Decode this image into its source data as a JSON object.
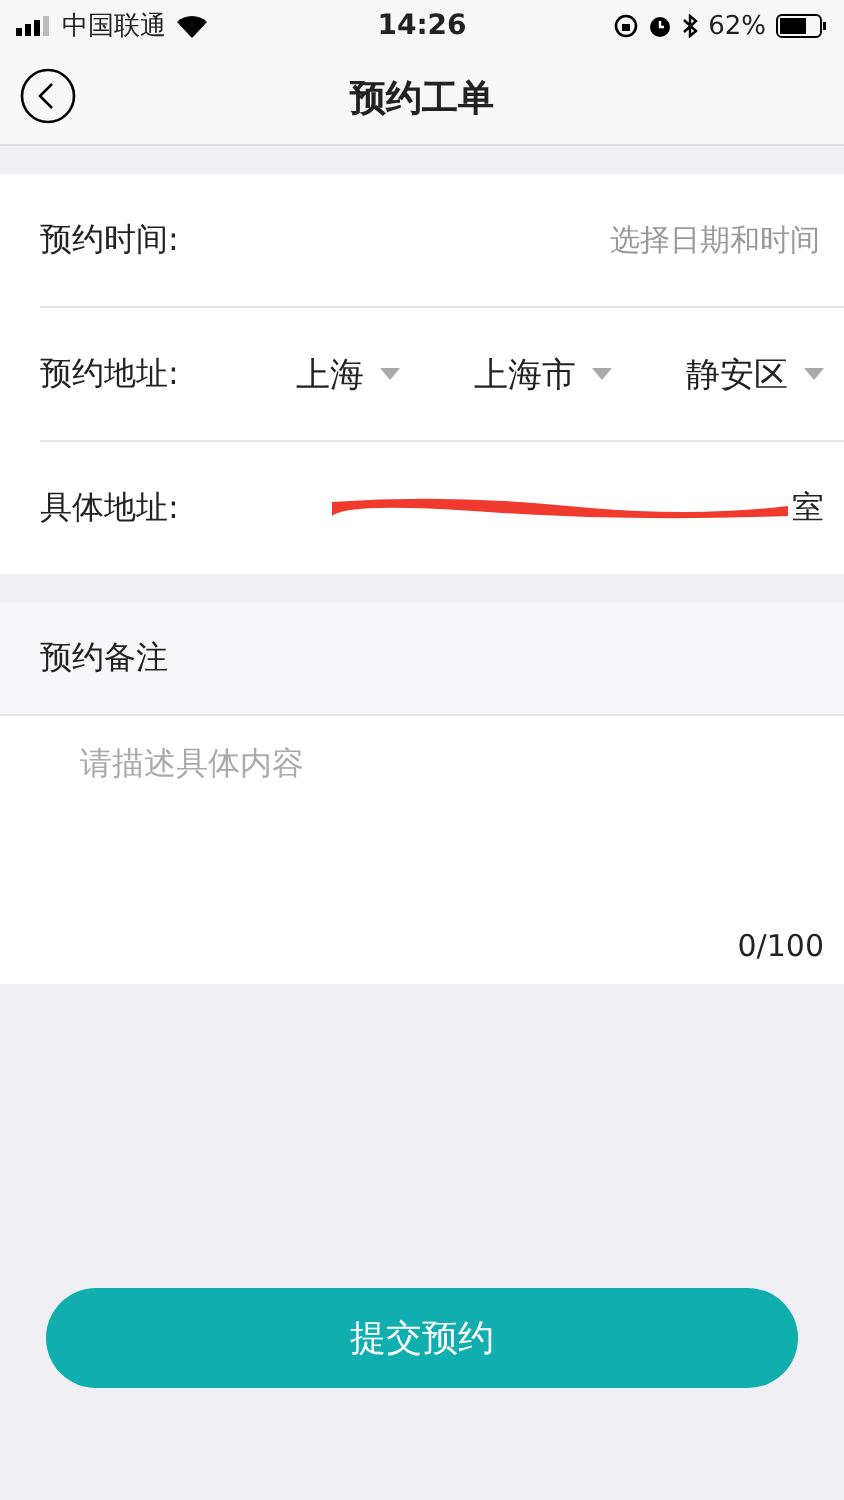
{
  "status_bar": {
    "carrier": "中国联通",
    "time": "14:26",
    "battery": "62%"
  },
  "nav": {
    "title": "预约工单"
  },
  "time_row": {
    "label": "预约时间:",
    "placeholder": "选择日期和时间"
  },
  "address_row": {
    "label": "预约地址:",
    "selects": [
      "上海",
      "上海市",
      "静安区"
    ]
  },
  "detail_row": {
    "label": "具体地址:",
    "value_visible": "室",
    "redacted": true
  },
  "note": {
    "label": "预约备注",
    "placeholder": "请描述具体内容",
    "counter": "0/100"
  },
  "submit": {
    "label": "提交预约"
  }
}
